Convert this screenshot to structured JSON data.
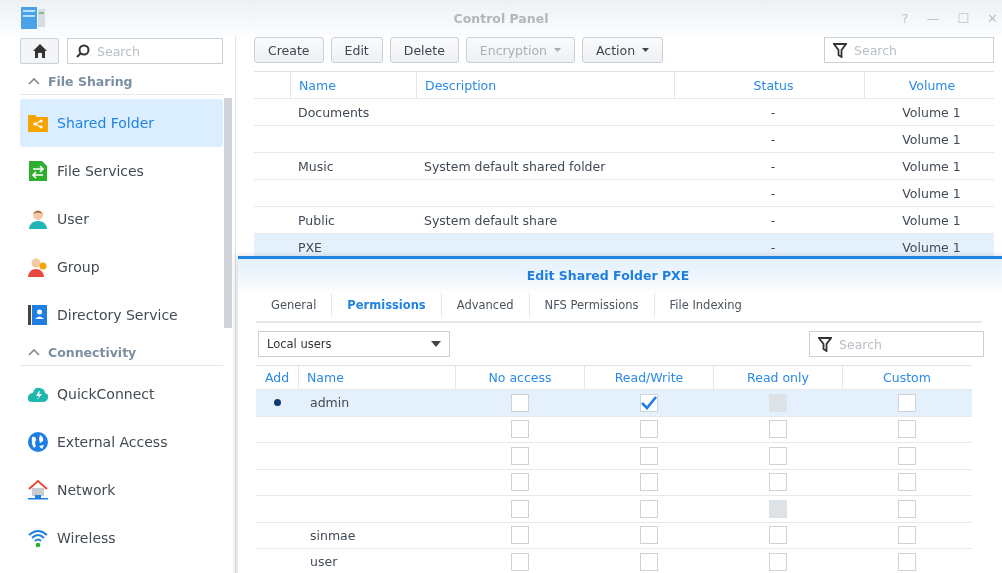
{
  "window": {
    "title": "Control Panel",
    "controls": [
      "?",
      "—",
      "☐",
      "✕"
    ]
  },
  "sidebar": {
    "search": {
      "placeholder": "Search"
    },
    "sections": [
      {
        "title": "File Sharing",
        "expanded": true,
        "items": [
          {
            "label": "Shared Folder",
            "selected": true
          },
          {
            "label": "File Services",
            "selected": false
          },
          {
            "label": "User",
            "selected": false
          },
          {
            "label": "Group",
            "selected": false
          },
          {
            "label": "Directory Service",
            "selected": false
          }
        ]
      },
      {
        "title": "Connectivity",
        "expanded": true,
        "items": [
          {
            "label": "QuickConnect",
            "selected": false
          },
          {
            "label": "External Access",
            "selected": false
          },
          {
            "label": "Network",
            "selected": false
          },
          {
            "label": "Wireless",
            "selected": false
          }
        ]
      }
    ]
  },
  "toolbar": {
    "buttons": [
      {
        "label": "Create",
        "disabled": false,
        "menu": false
      },
      {
        "label": "Edit",
        "disabled": false,
        "menu": false
      },
      {
        "label": "Delete",
        "disabled": false,
        "menu": false
      },
      {
        "label": "Encryption",
        "disabled": true,
        "menu": true
      },
      {
        "label": "Action",
        "disabled": false,
        "menu": true
      }
    ],
    "search": {
      "placeholder": "Search"
    }
  },
  "table": {
    "columns": [
      "Name",
      "Description",
      "Status",
      "Volume"
    ],
    "rows": [
      {
        "name": "Documents",
        "status": "-",
        "volume": "Volume 1",
        "selected": false
      },
      {
        "status": "-",
        "volume": "Volume 1",
        "selected": false
      },
      {
        "name": "Music",
        "description": "System default shared folder",
        "status": "-",
        "volume": "Volume 1",
        "selected": false
      },
      {
        "status": "-",
        "volume": "Volume 1",
        "selected": false
      },
      {
        "name": "Public",
        "description": "System default share",
        "status": "-",
        "volume": "Volume 1",
        "selected": false
      },
      {
        "name": "PXE",
        "status": "-",
        "volume": "Volume 1",
        "selected": true
      }
    ]
  },
  "dialog": {
    "title": "Edit Shared Folder PXE",
    "tabs": [
      {
        "label": "General",
        "selected": false
      },
      {
        "label": "Permissions",
        "selected": true
      },
      {
        "label": "Advanced",
        "selected": false
      },
      {
        "label": "NFS Permissions",
        "selected": false
      },
      {
        "label": "File Indexing",
        "selected": false
      }
    ],
    "user_type": {
      "value": "Local users"
    },
    "search": {
      "placeholder": "Search"
    },
    "columns": [
      "Add",
      "Name",
      "No access",
      "Read/Write",
      "Read only",
      "Custom"
    ],
    "rows": [
      {
        "added": true,
        "name": "admin",
        "selected": true,
        "permissions": [
          {
            "checked": false,
            "disabled": false
          },
          {
            "checked": true,
            "disabled": false
          },
          {
            "checked": false,
            "disabled": true
          },
          {
            "checked": false,
            "disabled": false
          }
        ]
      },
      {
        "added": false,
        "selected": false,
        "permissions": [
          {
            "checked": false,
            "disabled": false
          },
          {
            "checked": false,
            "disabled": false
          },
          {
            "checked": false,
            "disabled": false
          },
          {
            "checked": false,
            "disabled": false
          }
        ]
      },
      {
        "added": false,
        "selected": false,
        "permissions": [
          {
            "checked": false,
            "disabled": false
          },
          {
            "checked": false,
            "disabled": false
          },
          {
            "checked": false,
            "disabled": false
          },
          {
            "checked": false,
            "disabled": false
          }
        ]
      },
      {
        "added": false,
        "selected": false,
        "permissions": [
          {
            "checked": false,
            "disabled": false
          },
          {
            "checked": false,
            "disabled": false
          },
          {
            "checked": false,
            "disabled": false
          },
          {
            "checked": false,
            "disabled": false
          }
        ]
      },
      {
        "added": false,
        "selected": false,
        "permissions": [
          {
            "checked": false,
            "disabled": false
          },
          {
            "checked": false,
            "disabled": false
          },
          {
            "checked": false,
            "disabled": true
          },
          {
            "checked": false,
            "disabled": false
          }
        ]
      },
      {
        "added": false,
        "name": "sinmae",
        "selected": false,
        "permissions": [
          {
            "checked": false,
            "disabled": false
          },
          {
            "checked": false,
            "disabled": false
          },
          {
            "checked": false,
            "disabled": false
          },
          {
            "checked": false,
            "disabled": false
          }
        ]
      },
      {
        "added": false,
        "name": "user",
        "selected": false,
        "permissions": [
          {
            "checked": false,
            "disabled": false
          },
          {
            "checked": false,
            "disabled": false
          },
          {
            "checked": false,
            "disabled": false
          },
          {
            "checked": false,
            "disabled": false
          }
        ]
      }
    ]
  }
}
